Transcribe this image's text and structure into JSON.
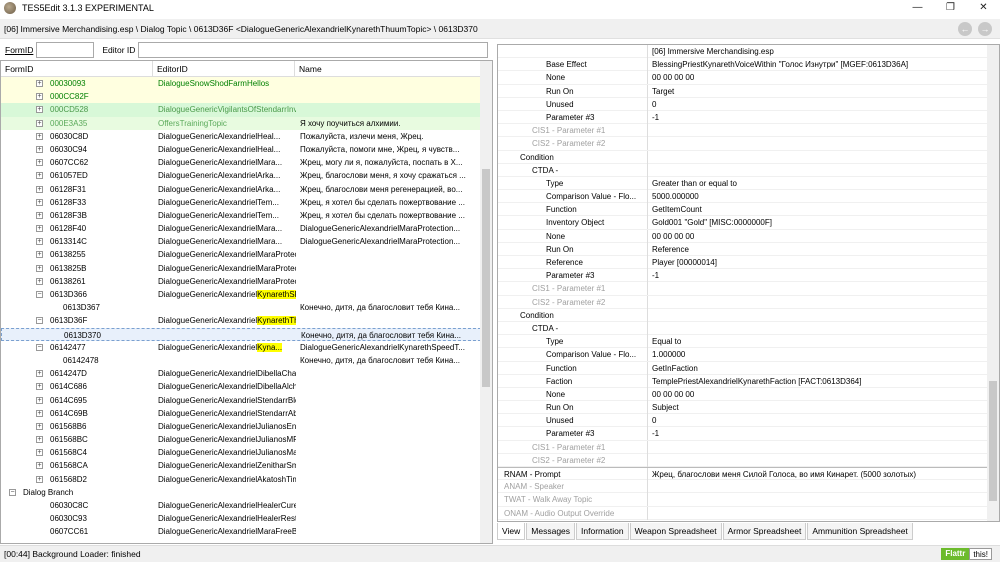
{
  "window": {
    "title": "TES5Edit 3.1.3 EXPERIMENTAL"
  },
  "path": "[06] Immersive Merchandising.esp \\ Dialog Topic \\ 0613D36F <DialogueGenericAlexandrielKynarethThuumTopic> \\ 0613D370",
  "filter": {
    "formid_label": "FormID",
    "editorid_label": "Editor ID",
    "formid_value": "",
    "editorid_value": ""
  },
  "tree": {
    "headers": [
      "FormID",
      "EditorID",
      "Name"
    ],
    "rows": [
      {
        "ind": 49,
        "exp": "+",
        "fid": "00030093",
        "eid": "DialogueSnowShodFarmHellos",
        "nm": "",
        "cls": "yellow"
      },
      {
        "ind": 49,
        "exp": "+",
        "fid": "000CC82F",
        "eid": "",
        "nm": "",
        "cls": "yellow"
      },
      {
        "ind": 49,
        "exp": "+",
        "fid": "000CD528",
        "eid": "DialogueGenericVigilantsOfStendarrInvis",
        "nm": "",
        "cls": "green"
      },
      {
        "ind": 49,
        "exp": "+",
        "fid": "000E3A35",
        "eid": "OffersTrainingTopic",
        "nm": "Я хочу поучиться алхимии.",
        "cls": "green2"
      },
      {
        "ind": 49,
        "exp": "+",
        "fid": "06030C8D",
        "eid": "DialogueGenericAlexandrielHeal...",
        "nm": "Пожалуйста, излечи меня, Жрец.",
        "cls": ""
      },
      {
        "ind": 49,
        "exp": "+",
        "fid": "06030C94",
        "eid": "DialogueGenericAlexandrielHeal...",
        "nm": "Пожалуйста, помоги мне, Жрец, я чувств...",
        "cls": ""
      },
      {
        "ind": 49,
        "exp": "+",
        "fid": "0607CC62",
        "eid": "DialogueGenericAlexandrielMara...",
        "nm": "Жрец, могу ли я, пожалуйста, поспать в Х...",
        "cls": ""
      },
      {
        "ind": 49,
        "exp": "+",
        "fid": "061057ED",
        "eid": "DialogueGenericAlexandrielArka...",
        "nm": "Жрец, благослови меня, я хочу сражаться ...",
        "cls": ""
      },
      {
        "ind": 49,
        "exp": "+",
        "fid": "06128F31",
        "eid": "DialogueGenericAlexandrielArka...",
        "nm": "Жрец, благослови меня регенерацией, во...",
        "cls": ""
      },
      {
        "ind": 49,
        "exp": "+",
        "fid": "06128F33",
        "eid": "DialogueGenericAlexandrielTem...",
        "nm": "Жрец, я хотел бы сделать пожертвование ...",
        "cls": ""
      },
      {
        "ind": 49,
        "exp": "+",
        "fid": "06128F3B",
        "eid": "DialogueGenericAlexandrielTem...",
        "nm": "Жрец, я хотел бы сделать пожертвование ...",
        "cls": ""
      },
      {
        "ind": 49,
        "exp": "+",
        "fid": "06128F40",
        "eid": "DialogueGenericAlexandrielMara...",
        "nm": "DialogueGenericAlexandrielMaraProtection...",
        "cls": ""
      },
      {
        "ind": 49,
        "exp": "+",
        "fid": "0613314C",
        "eid": "DialogueGenericAlexandrielMara...",
        "nm": "DialogueGenericAlexandrielMaraProtection...",
        "cls": ""
      },
      {
        "ind": 49,
        "exp": "+",
        "fid": "06138255",
        "eid": "DialogueGenericAlexandrielMaraProtectionFrostTopic",
        "nm": "",
        "cls": ""
      },
      {
        "ind": 49,
        "exp": "+",
        "fid": "0613825B",
        "eid": "DialogueGenericAlexandrielMaraProtectionShockTopic",
        "nm": "",
        "cls": ""
      },
      {
        "ind": 49,
        "exp": "+",
        "fid": "06138261",
        "eid": "DialogueGenericAlexandrielMaraProtectionMagickaTopic",
        "nm": "",
        "cls": ""
      },
      {
        "ind": 49,
        "exp": "−",
        "fid": "0613D366",
        "eid": "DialogueGenericAlexandriel",
        "eidhl": "KynarethSRTopic",
        "nm": "",
        "cls": ""
      },
      {
        "ind": 62,
        "exp": "",
        "fid": "0613D367",
        "eid": "",
        "nm": "Конечно, дитя, да благословит тебя Кина...",
        "cls": ""
      },
      {
        "ind": 49,
        "exp": "−",
        "fid": "0613D36F",
        "eid": "DialogueGenericAlexandriel",
        "eidhl": "KynarethThuumTopic",
        "nm": "",
        "cls": ""
      },
      {
        "ind": 62,
        "exp": "",
        "fid": "0613D370",
        "eid": "",
        "nm": "Конечно, дитя, да благословит тебя Кина...",
        "cls": "sel"
      },
      {
        "ind": 49,
        "exp": "−",
        "fid": "06142477",
        "eid": "DialogueGenericAlexandriel",
        "eidhl": "Kyna...",
        "nm": "DialogueGenericAlexandrielKynarethSpeedT...",
        "cls": ""
      },
      {
        "ind": 62,
        "exp": "",
        "fid": "06142478",
        "eid": "",
        "nm": "Конечно, дитя, да благословит тебя Кина...",
        "cls": ""
      },
      {
        "ind": 49,
        "exp": "+",
        "fid": "0614247D",
        "eid": "DialogueGenericAlexandrielDibellaCharismaTopic",
        "nm": "",
        "cls": ""
      },
      {
        "ind": 49,
        "exp": "+",
        "fid": "0614C686",
        "eid": "DialogueGenericAlexandrielDibellaAlchemyTopic",
        "nm": "",
        "cls": ""
      },
      {
        "ind": 49,
        "exp": "+",
        "fid": "0614C695",
        "eid": "DialogueGenericAlexandrielStendarrBlockTopic",
        "nm": "",
        "cls": ""
      },
      {
        "ind": 49,
        "exp": "+",
        "fid": "0614C69B",
        "eid": "DialogueGenericAlexandrielStendarrAbsorbTopic",
        "nm": "",
        "cls": ""
      },
      {
        "ind": 49,
        "exp": "+",
        "fid": "061568B6",
        "eid": "DialogueGenericAlexandrielJulianosEnchantingTopic",
        "nm": "",
        "cls": ""
      },
      {
        "ind": 49,
        "exp": "+",
        "fid": "061568BC",
        "eid": "DialogueGenericAlexandrielJulianosMRTopic",
        "nm": "",
        "cls": ""
      },
      {
        "ind": 49,
        "exp": "+",
        "fid": "061568C4",
        "eid": "DialogueGenericAlexandrielJulianosMagickaTopic",
        "nm": "",
        "cls": ""
      },
      {
        "ind": 49,
        "exp": "+",
        "fid": "061568CA",
        "eid": "DialogueGenericAlexandrielZenitharSmithingTopic",
        "nm": "",
        "cls": ""
      },
      {
        "ind": 49,
        "exp": "+",
        "fid": "061568D2",
        "eid": "DialogueGenericAlexandrielAkatoshTimeTopic",
        "nm": "",
        "cls": ""
      },
      {
        "ind": 22,
        "exp": "−",
        "fid": "Dialog Branch",
        "eid": "",
        "nm": "",
        "cls": ""
      },
      {
        "ind": 49,
        "exp": "",
        "fid": "06030C8C",
        "eid": "DialogueGenericAlexandrielHealerCure",
        "nm": "",
        "cls": ""
      },
      {
        "ind": 49,
        "exp": "",
        "fid": "06030C93",
        "eid": "DialogueGenericAlexandrielHealerRestoreHealth",
        "nm": "",
        "cls": ""
      },
      {
        "ind": 49,
        "exp": "",
        "fid": "0607CC61",
        "eid": "DialogueGenericAlexandrielMaraFreeBed",
        "nm": "",
        "cls": ""
      }
    ]
  },
  "record": {
    "header": "[06] Immersive Merchandising.esp",
    "rows": [
      {
        "k": "Base Effect",
        "ind": 48,
        "v": "BlessingPriestKynarethVoiceWithin \"Голос Изнутри\" [MGEF:0613D36A]",
        "g": false
      },
      {
        "k": "None",
        "ind": 48,
        "v": "00 00 00 00",
        "g": false
      },
      {
        "k": "Run On",
        "ind": 48,
        "v": "Target",
        "g": false
      },
      {
        "k": "Unused",
        "ind": 48,
        "v": "0",
        "g": false
      },
      {
        "k": "Parameter #3",
        "ind": 48,
        "v": "-1",
        "g": false
      },
      {
        "k": "CIS1 - Parameter #1",
        "ind": 34,
        "v": "",
        "g": true
      },
      {
        "k": "CIS2 - Parameter #2",
        "ind": 34,
        "v": "",
        "g": true
      },
      {
        "k": "Condition",
        "ind": 22,
        "v": "",
        "g": false
      },
      {
        "k": "CTDA -",
        "ind": 34,
        "v": "",
        "g": false
      },
      {
        "k": "Type",
        "ind": 48,
        "v": "Greater than or equal to",
        "g": false
      },
      {
        "k": "Comparison Value - Flo...",
        "ind": 48,
        "v": "5000.000000",
        "g": false
      },
      {
        "k": "Function",
        "ind": 48,
        "v": "GetItemCount",
        "g": false
      },
      {
        "k": "Inventory Object",
        "ind": 48,
        "v": "Gold001 \"Gold\" [MISC:0000000F]",
        "g": false
      },
      {
        "k": "None",
        "ind": 48,
        "v": "00 00 00 00",
        "g": false
      },
      {
        "k": "Run On",
        "ind": 48,
        "v": "Reference",
        "g": false
      },
      {
        "k": "Reference",
        "ind": 48,
        "v": "Player [00000014]",
        "g": false
      },
      {
        "k": "Parameter #3",
        "ind": 48,
        "v": "-1",
        "g": false
      },
      {
        "k": "CIS1 - Parameter #1",
        "ind": 34,
        "v": "",
        "g": true
      },
      {
        "k": "CIS2 - Parameter #2",
        "ind": 34,
        "v": "",
        "g": true
      },
      {
        "k": "Condition",
        "ind": 22,
        "v": "",
        "g": false
      },
      {
        "k": "CTDA -",
        "ind": 34,
        "v": "",
        "g": false
      },
      {
        "k": "Type",
        "ind": 48,
        "v": "Equal to",
        "g": false
      },
      {
        "k": "Comparison Value - Flo...",
        "ind": 48,
        "v": "1.000000",
        "g": false
      },
      {
        "k": "Function",
        "ind": 48,
        "v": "GetInFaction",
        "g": false
      },
      {
        "k": "Faction",
        "ind": 48,
        "v": "TemplePriestAlexandrielKynarethFaction [FACT:0613D364]",
        "g": false
      },
      {
        "k": "None",
        "ind": 48,
        "v": "00 00 00 00",
        "g": false
      },
      {
        "k": "Run On",
        "ind": 48,
        "v": "Subject",
        "g": false
      },
      {
        "k": "Unused",
        "ind": 48,
        "v": "0",
        "g": false
      },
      {
        "k": "Parameter #3",
        "ind": 48,
        "v": "-1",
        "g": false
      },
      {
        "k": "CIS1 - Parameter #1",
        "ind": 34,
        "v": "",
        "g": true
      },
      {
        "k": "CIS2 - Parameter #2",
        "ind": 34,
        "v": "",
        "g": true
      },
      {
        "k": "RNAM - Prompt",
        "ind": 6,
        "v": "Жрец, благослови меня Силой Голоса, во имя Кинарет. (5000 золотых)",
        "g": false,
        "sep": true
      },
      {
        "k": "ANAM - Speaker",
        "ind": 6,
        "v": "",
        "g": true
      },
      {
        "k": "TWAT - Walk Away Topic",
        "ind": 6,
        "v": "",
        "g": true
      },
      {
        "k": "ONAM - Audio Output Override",
        "ind": 6,
        "v": "",
        "g": true
      }
    ]
  },
  "tabs": [
    "View",
    "Messages",
    "Information",
    "Weapon Spreadsheet",
    "Armor Spreadsheet",
    "Ammunition Spreadsheet"
  ],
  "status": {
    "text": "[00:44] Background Loader: finished",
    "flattr": "Flattr",
    "this": "this!"
  },
  "colors": {
    "yellow_row": "#ffffe0",
    "green_row": "#d8f8d8",
    "highlight": "#ffff00",
    "flattr": "#6cbb2c"
  }
}
